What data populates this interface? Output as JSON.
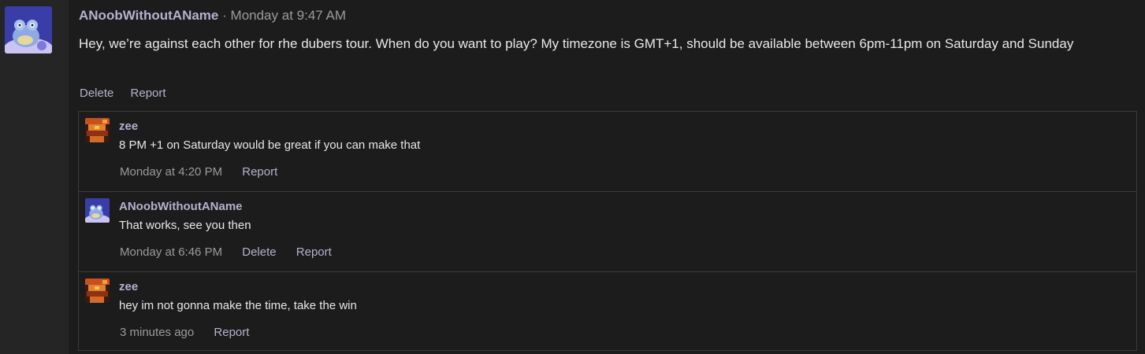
{
  "main_post": {
    "author": "ANoobWithoutAName",
    "separator": "·",
    "timestamp": "Monday at 9:47 AM",
    "body": "Hey, we’re against each other for rhe dubers tour. When do you want to play? My timezone is GMT+1, should be available between 6pm-11pm on Saturday and Sunday",
    "actions": {
      "delete": "Delete",
      "report": "Report"
    }
  },
  "replies": [
    {
      "author": "zee",
      "body": "8 PM +1 on Saturday would be great if you can make that",
      "timestamp": "Monday at 4:20 PM",
      "report": "Report"
    },
    {
      "author": "ANoobWithoutAName",
      "body": "That works, see you then",
      "timestamp": "Monday at 6:46 PM",
      "delete": "Delete",
      "report": "Report"
    },
    {
      "author": "zee",
      "body": "hey im not gonna make the time, take the win",
      "timestamp": "3 minutes ago",
      "report": "Report"
    }
  ],
  "colors": {
    "background": "#1c1c1c",
    "sidebar": "#252525",
    "username": "#b8b0cf",
    "meta": "#9b9b9b",
    "text": "#e8e8e8"
  },
  "icons": {
    "main_avatar": "frog-avatar-icon",
    "zee_avatar": "pixel-art-avatar-icon"
  }
}
